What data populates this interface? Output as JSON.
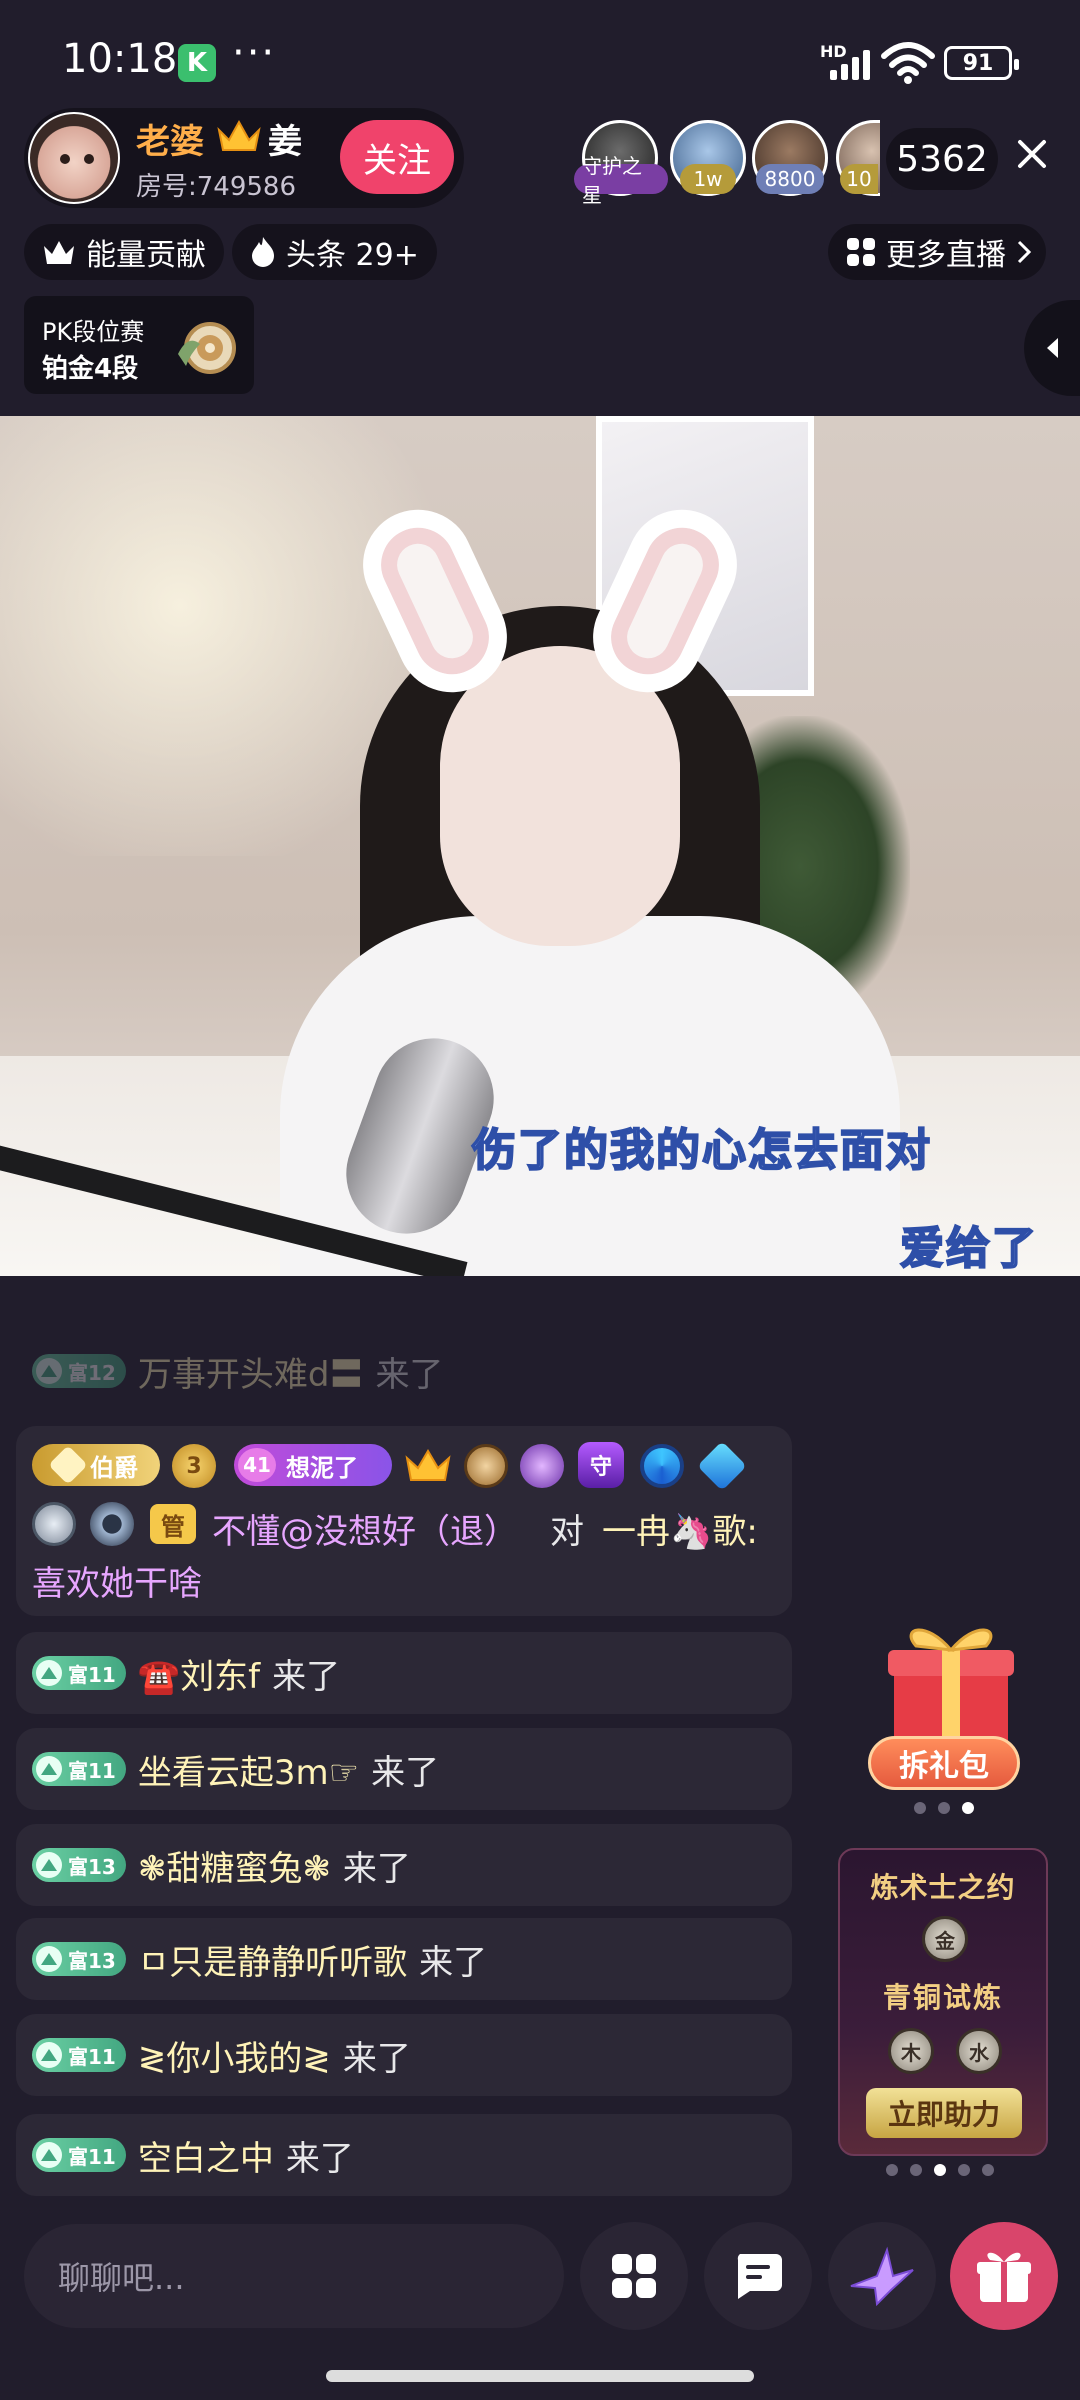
{
  "status_bar": {
    "time": "10:18",
    "battery": "91",
    "network_label": "HD"
  },
  "host": {
    "name": "老婆",
    "name_suffix": "姜",
    "room_number": "房号:749586",
    "follow_label": "关注"
  },
  "viewers": [
    {
      "badge": "守护之星",
      "badge_color": "#7a3ea3"
    },
    {
      "badge": "1w",
      "badge_color": "#b59b3a"
    },
    {
      "badge": "8800",
      "badge_color": "#6f7fb6"
    },
    {
      "badge": "10",
      "badge_color": "#b59b3a"
    }
  ],
  "viewer_count": "5362",
  "chips": {
    "energy": "能量贡献",
    "headline": "头条 29+",
    "more_live": "更多直播"
  },
  "pk": {
    "title": "PK段位赛",
    "rank": "铂金4段"
  },
  "lyrics": {
    "line1": "伤了的我的心怎去面对",
    "line2": "爱给了你"
  },
  "chat": {
    "faded_item": {
      "level": "富12",
      "name": "万事开头难d〓",
      "action": "来了"
    },
    "rich_item": {
      "badge_title": "伯爵",
      "badge_level_num": "41",
      "badge_tag": "想泥了",
      "badge_guard": "守",
      "badge_guard_sub": "1",
      "badge_admin": "管",
      "text_line1_prefix": "不懂@没想好（退）",
      "text_line1_mid": "对",
      "text_line1_target": "一冉🦄歌:",
      "text_line2": "喜欢她干啥"
    },
    "items": [
      {
        "level": "富11",
        "name": "☎️刘东f",
        "action": "来了"
      },
      {
        "level": "富11",
        "name": "坐看云起3m☞",
        "action": "来了"
      },
      {
        "level": "富13",
        "name": "❃甜糖蜜兔❃",
        "action": "来了"
      },
      {
        "level": "富13",
        "name": "ㅁ只是静静听听歌",
        "action": "来了"
      },
      {
        "level": "富11",
        "name": "≷你小我的≷",
        "action": "来了"
      },
      {
        "level": "富11",
        "name": "空白之中",
        "action": "来了"
      }
    ]
  },
  "widgets": {
    "gift_pack_label": "拆礼包",
    "event_title": "炼术士之约",
    "event_subtitle": "青铜试炼",
    "event_coin_top": "金",
    "event_coin_left": "木",
    "event_coin_right": "水",
    "event_button": "立即助力"
  },
  "bottom_bar": {
    "input_placeholder": "聊聊吧..."
  },
  "colors": {
    "accent": "#f0436b",
    "background": "#211d2c",
    "gift": "#d9456b"
  }
}
